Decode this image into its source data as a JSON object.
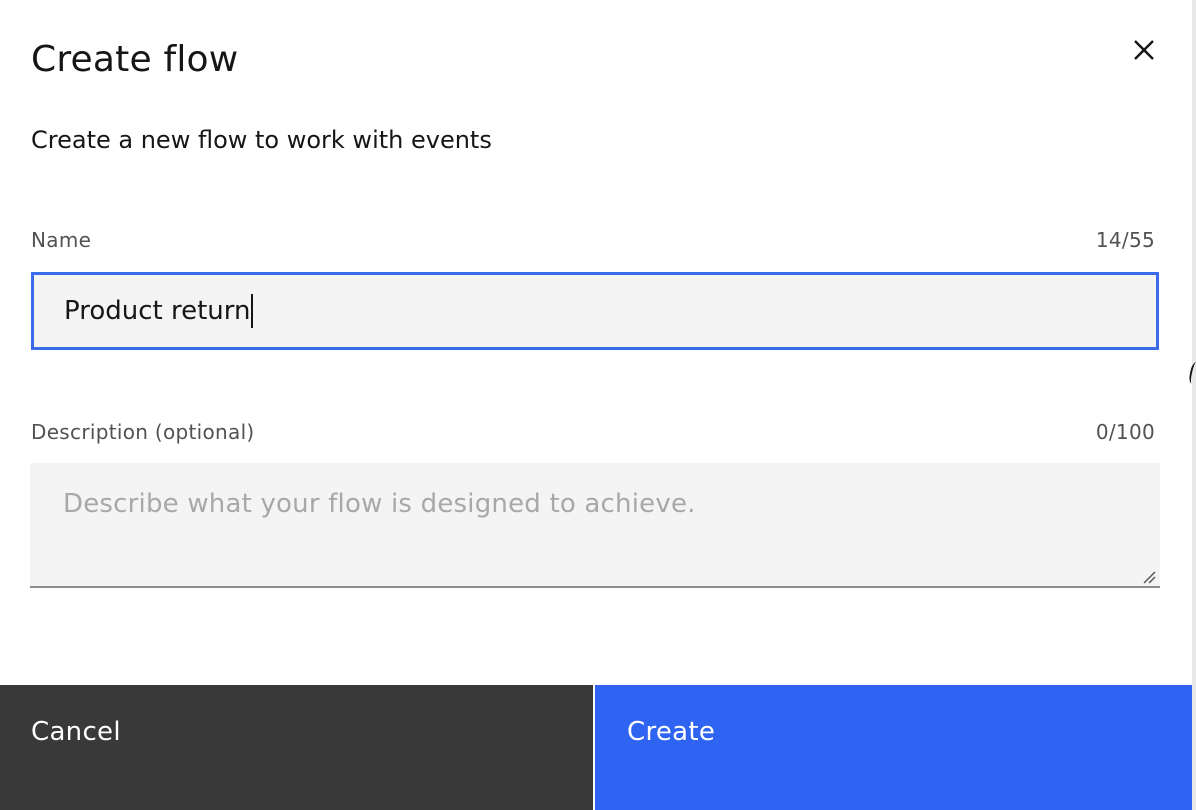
{
  "dialog": {
    "title": "Create flow",
    "subtitle": "Create a new flow to work with events",
    "close_icon": "close-icon"
  },
  "name_field": {
    "label": "Name",
    "counter": "14/55",
    "value": "Product return",
    "focused": true,
    "focus_color": "#3a6be8"
  },
  "description_field": {
    "label": "Description (optional)",
    "counter": "0/100",
    "value": "",
    "placeholder": "Describe what your flow is designed to achieve."
  },
  "footer": {
    "cancel_label": "Cancel",
    "create_label": "Create",
    "cancel_color": "#393939",
    "create_color": "#2f63f1"
  }
}
